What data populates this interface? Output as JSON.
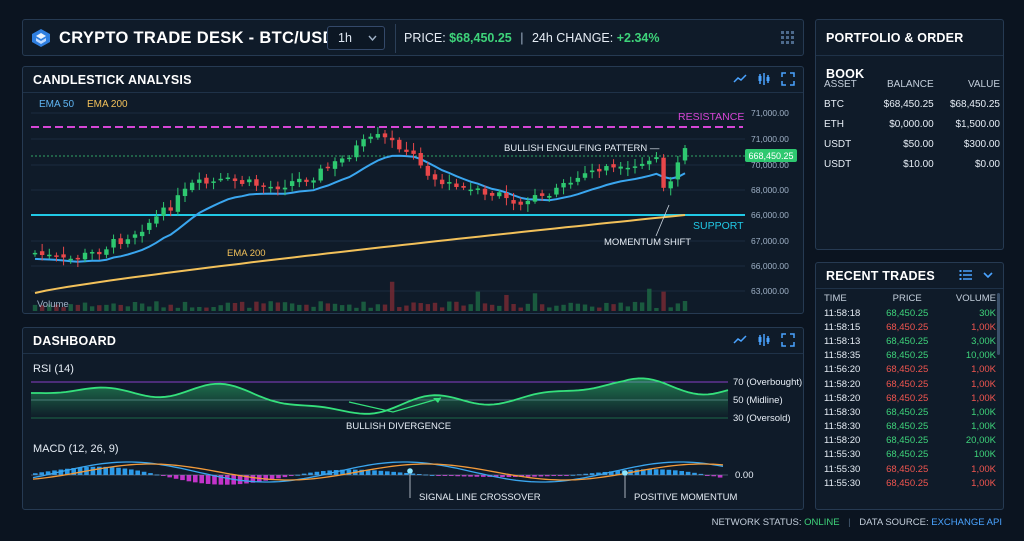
{
  "header": {
    "title": "CRYPTO TRADE DESK - BTC/USD",
    "timeframe": "1h",
    "price_label": "PRICE:",
    "price_value": "$68,450.25",
    "change_label": "24h CHANGE:",
    "change_value": "+2.34%"
  },
  "candle_panel": {
    "title": "CANDLESTICK ANALYSIS",
    "legend_ema50": "EMA 50",
    "legend_ema200": "EMA 200",
    "resistance_label": "RESISTANCE",
    "support_label": "SUPPORT",
    "pattern_label": "BULLISH ENGULFING PATTERN —",
    "momentum_label": "MOMENTUM SHIFT",
    "ema200_label": "EMA 200",
    "volume_label": "Volume",
    "current_price_tag": "668,450.25",
    "y_ticks": [
      "71,000.00",
      "71,000.00",
      "70,000.00",
      "68,000.00",
      "66,000.00",
      "67,000.00",
      "66,000.00",
      "63,000.00"
    ],
    "colors": {
      "up": "#2ec870",
      "down": "#e8474a",
      "ema50": "#3aa6ef",
      "ema200": "#f2c15a",
      "resistance": "#d646d6",
      "support": "#21c9e6"
    }
  },
  "dash_panel": {
    "title": "DASHBOARD",
    "rsi_title": "RSI (14)",
    "rsi_levels": [
      "70 (Overbought)",
      "50 (Midline)",
      "30 (Oversold)"
    ],
    "divergence_label": "BULLISH DIVERGENCE",
    "macd_title": "MACD (12, 26, 9)",
    "macd_zero": "0.00",
    "crossover_label": "SIGNAL LINE CROSSOVER",
    "positive_label": "POSITIVE MOMENTUM"
  },
  "portfolio": {
    "title": "PORTFOLIO & ORDER BOOK",
    "columns": [
      "ASSET",
      "BALANCE",
      "VALUE"
    ],
    "rows": [
      [
        "BTC",
        "$68,450.25",
        "$68,450.25"
      ],
      [
        "ETH",
        "$0,000.00",
        "$1,500.00"
      ],
      [
        "USDT",
        "$50.00",
        "$300.00"
      ],
      [
        "USDT",
        "$10.00",
        "$0.00"
      ]
    ]
  },
  "trades": {
    "title": "RECENT TRADES",
    "columns": [
      "TIME",
      "PRICE",
      "VOLUME"
    ],
    "rows": [
      {
        "time": "11:58:18",
        "price": "68,450.25",
        "volume": "30K",
        "side": "up"
      },
      {
        "time": "11:58:15",
        "price": "68,450.25",
        "volume": "1,00K",
        "side": "dn"
      },
      {
        "time": "11:58:13",
        "price": "68,450.25",
        "volume": "3,00K",
        "side": "up"
      },
      {
        "time": "11:58:35",
        "price": "68,450.25",
        "volume": "10,00K",
        "side": "up"
      },
      {
        "time": "11:56:20",
        "price": "68,450.25",
        "volume": "1,00K",
        "side": "dn"
      },
      {
        "time": "11:58:20",
        "price": "68,450.25",
        "volume": "1,00K",
        "side": "dn"
      },
      {
        "time": "11:58:20",
        "price": "68,450.25",
        "volume": "1,00K",
        "side": "dn"
      },
      {
        "time": "11:58:30",
        "price": "68,450.25",
        "volume": "1,00K",
        "side": "up"
      },
      {
        "time": "11:58:30",
        "price": "68,450.25",
        "volume": "1,00K",
        "side": "up"
      },
      {
        "time": "11:58:20",
        "price": "68,450.25",
        "volume": "20,00K",
        "side": "up"
      },
      {
        "time": "11:55:30",
        "price": "68,450.25",
        "volume": "100K",
        "side": "up"
      },
      {
        "time": "11:55:30",
        "price": "68,450.25",
        "volume": "1,00K",
        "side": "dn"
      },
      {
        "time": "11:55:30",
        "price": "68,450.25",
        "volume": "1,00K",
        "side": "dn"
      }
    ]
  },
  "footer": {
    "network_label": "NETWORK STATUS:",
    "network_value": "ONLINE",
    "source_label": "DATA SOURCE:",
    "source_value": "EXCHANGE API"
  }
}
